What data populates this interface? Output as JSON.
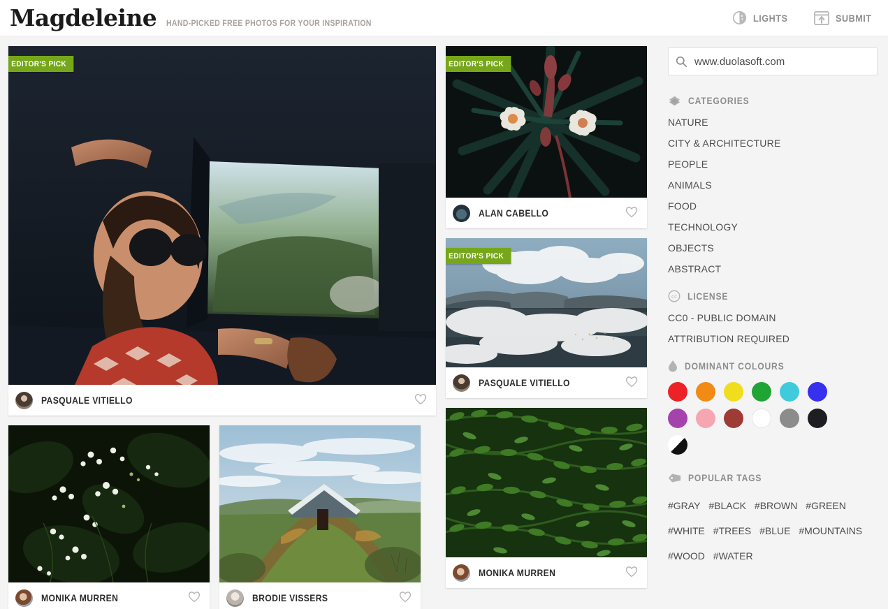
{
  "header": {
    "logo": "Magdeleine",
    "tagline": "HAND-PICKED FREE PHOTOS FOR YOUR INSPIRATION",
    "lights_label": "LIGHTS",
    "submit_label": "SUBMIT",
    "lights_icon": "half-circle-icon",
    "submit_icon": "upload-window-icon"
  },
  "badge_label": "EDITOR'S PICK",
  "badge_color": "#76a71a",
  "gallery": {
    "left_column": {
      "feature": {
        "author": "PASQUALE VITIELLO",
        "editors_pick": true,
        "alt": "woman in sunglasses leaning out of a moving car window"
      },
      "small_left": {
        "author": "MONIKA MURREN",
        "editors_pick": false,
        "alt": "white wildflowers on dark green foliage"
      },
      "small_right": {
        "author": "BRODIE VISSERS",
        "editors_pick": false,
        "alt": "turf-roofed stone hut on a grassy hill"
      }
    },
    "right_column": {
      "top": {
        "author": "ALAN CABELLO",
        "editors_pick": true,
        "alt": "white oleander flowers against dark leaves"
      },
      "middle": {
        "author": "PASQUALE VITIELLO",
        "editors_pick": true,
        "alt": "aerial view of clouds over a coastal mountain"
      },
      "bottom": {
        "author": "MONIKA MURREN",
        "editors_pick": false,
        "alt": "dense green fern fronds"
      }
    }
  },
  "sidebar": {
    "search": {
      "value": "www.duolasoft.com",
      "placeholder": "Search",
      "icon": "search-icon"
    },
    "categories": {
      "title": "CATEGORIES",
      "icon": "tag-stack-icon",
      "items": [
        "NATURE",
        "CITY & ARCHITECTURE",
        "PEOPLE",
        "ANIMALS",
        "FOOD",
        "TECHNOLOGY",
        "OBJECTS",
        "ABSTRACT"
      ]
    },
    "license": {
      "title": "LICENSE",
      "icon": "creative-commons-icon",
      "items": [
        "CC0 - PUBLIC DOMAIN",
        "ATTRIBUTION REQUIRED"
      ]
    },
    "colours": {
      "title": "DOMINANT COLOURS",
      "icon": "droplet-icon",
      "swatches": [
        {
          "name": "red",
          "hex": "#ec2227"
        },
        {
          "name": "orange",
          "hex": "#f18b13"
        },
        {
          "name": "yellow",
          "hex": "#f0dd1c"
        },
        {
          "name": "green",
          "hex": "#20a434"
        },
        {
          "name": "cyan",
          "hex": "#3fcbdc"
        },
        {
          "name": "blue",
          "hex": "#3730ef"
        },
        {
          "name": "purple",
          "hex": "#a543ac"
        },
        {
          "name": "pink",
          "hex": "#f6a6b1"
        },
        {
          "name": "brown",
          "hex": "#9e3b35"
        },
        {
          "name": "white",
          "hex": "#ffffff"
        },
        {
          "name": "gray",
          "hex": "#8c8c8c"
        },
        {
          "name": "black",
          "hex": "#1d1d22"
        },
        {
          "name": "black-and-white",
          "hex": "#000000"
        }
      ]
    },
    "tags": {
      "title": "POPULAR TAGS",
      "icon": "price-tag-icon",
      "items": [
        "#GRAY",
        "#BLACK",
        "#BROWN",
        "#GREEN",
        "#WHITE",
        "#TREES",
        "#BLUE",
        "#MOUNTAINS",
        "#WOOD",
        "#WATER"
      ]
    }
  }
}
